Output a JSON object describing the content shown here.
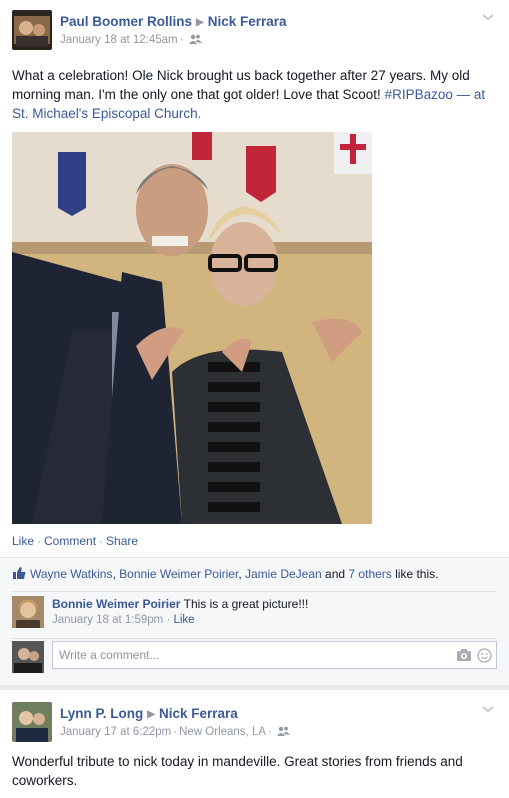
{
  "post1": {
    "author": "Paul Boomer Rollins",
    "target": "Nick Ferrara",
    "timestamp": "January 18 at 12:45am",
    "text": "What a celebration! Ole Nick brought us back together after 27 years. My old morning man. I'm the only one that got older! Love that Scoot!",
    "hashtag": "#RIPBazoo",
    "at_dash": "—",
    "at_prefix": "at",
    "place": "St. Michael's Episcopal Church.",
    "actions": {
      "like": "Like",
      "comment": "Comment",
      "share": "Share"
    },
    "likes": {
      "names": [
        "Wayne Watkins",
        "Bonnie Weimer Poirier",
        "Jamie DeJean"
      ],
      "and": "and",
      "others": "7 others",
      "suffix": "like this."
    },
    "comment": {
      "author": "Bonnie Weimer Poirier",
      "text": "This is a great picture!!!",
      "timestamp": "January 18 at 1:59pm",
      "like": "Like"
    },
    "write_placeholder": "Write a comment..."
  },
  "post2": {
    "author": "Lynn P. Long",
    "target": "Nick Ferrara",
    "timestamp": "January 17 at 6:22pm",
    "location": "New Orleans, LA",
    "text": "Wonderful tribute to nick today in mandeville. Great stories from friends and coworkers."
  },
  "colors": {
    "link": "#3b5998",
    "meta": "#9197a3",
    "background": "#e9ebee"
  }
}
